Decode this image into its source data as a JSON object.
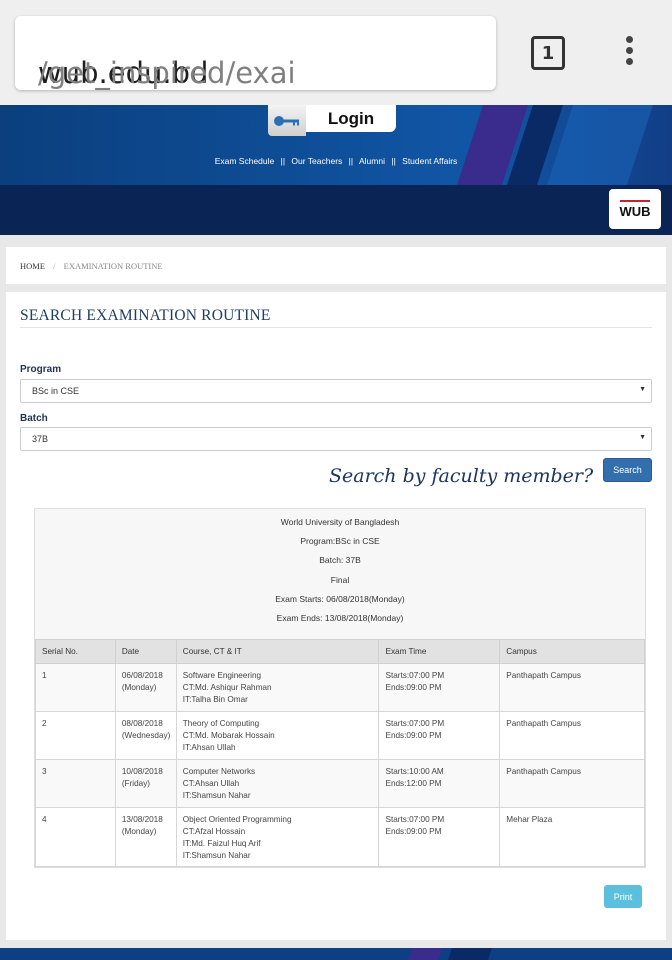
{
  "browser": {
    "url_host": "wub.edu.bd",
    "url_path": "/get_inspired/exai",
    "tab_count": "1"
  },
  "header": {
    "login_label": "Login",
    "nav": [
      "Exam Schedule",
      "Our Teachers",
      "Alumni",
      "Student Affairs"
    ],
    "nav_separator": "||",
    "logo_text": "WUB"
  },
  "breadcrumb": {
    "home": "HOME",
    "separator": "/",
    "current": "EXAMINATION ROUTINE"
  },
  "form": {
    "title": "SEARCH EXAMINATION ROUTINE",
    "program_label": "Program",
    "program_value": "BSc in CSE",
    "batch_label": "Batch",
    "batch_value": "37B",
    "faculty_prompt": "Search by faculty member?",
    "search_label": "Search"
  },
  "routine": {
    "header_lines": [
      "World University of Bangladesh",
      "Program:BSc in CSE",
      "Batch: 37B",
      "Final",
      "Exam Starts: 06/08/2018(Monday)",
      "Exam Ends: 13/08/2018(Monday)"
    ],
    "columns": [
      "Serial No.",
      "Date",
      "Course, CT & IT",
      "Exam Time",
      "Campus"
    ],
    "rows": [
      {
        "serial": "1",
        "date": [
          "06/08/2018",
          "(Monday)"
        ],
        "course": [
          "Software Engineering",
          "CT:Md. Ashiqur Rahman",
          "IT:Talha Bin Omar"
        ],
        "time": [
          "Starts:07:00 PM",
          "Ends:09:00 PM"
        ],
        "campus": "Panthapath Campus"
      },
      {
        "serial": "2",
        "date": [
          "08/08/2018",
          "(Wednesday)"
        ],
        "course": [
          "Theory of Computing",
          "CT:Md. Mobarak Hossain",
          "IT:Ahsan Ullah"
        ],
        "time": [
          "Starts:07:00 PM",
          "Ends:09:00 PM"
        ],
        "campus": "Panthapath Campus"
      },
      {
        "serial": "3",
        "date": [
          "10/08/2018",
          "(Friday)"
        ],
        "course": [
          "Computer Networks",
          "CT:Ahsan Ullah",
          "IT:Shamsun Nahar"
        ],
        "time": [
          "Starts:10:00 AM",
          "Ends:12:00 PM"
        ],
        "campus": "Panthapath Campus"
      },
      {
        "serial": "4",
        "date": [
          "13/08/2018",
          "(Monday)"
        ],
        "course": [
          "Object Oriented Programming",
          "CT:Afzal Hossain",
          "IT:Md. Faizul Huq Arif",
          "IT:Shamsun Nahar"
        ],
        "time": [
          "Starts:07:00 PM",
          "Ends:09:00 PM"
        ],
        "campus": "Mehar Plaza"
      }
    ],
    "print_label": "Print"
  }
}
